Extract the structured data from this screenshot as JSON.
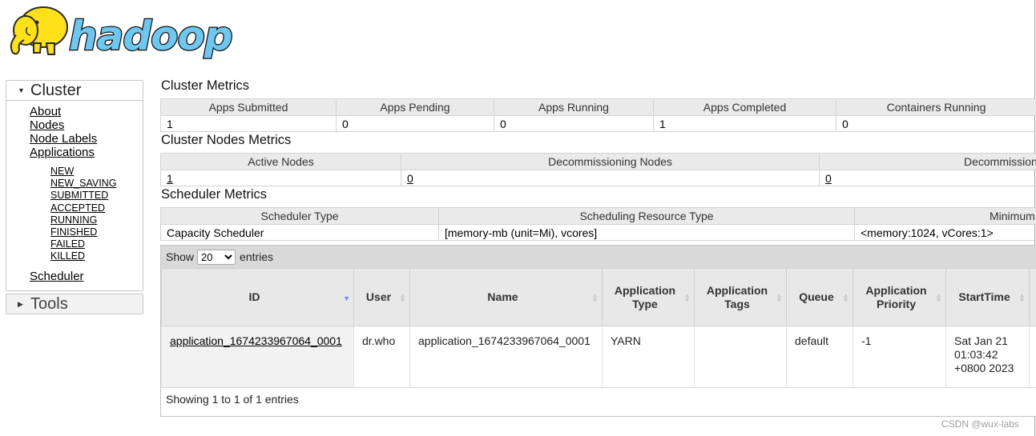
{
  "brand": {
    "logo_text": "hadoop"
  },
  "sidebar": {
    "cluster_header": "Cluster",
    "tools_header": "Tools",
    "links": [
      "About",
      "Nodes",
      "Node Labels",
      "Applications"
    ],
    "app_states": [
      "NEW",
      "NEW_SAVING",
      "SUBMITTED",
      "ACCEPTED",
      "RUNNING",
      "FINISHED",
      "FAILED",
      "KILLED"
    ],
    "scheduler": "Scheduler"
  },
  "cluster_metrics": {
    "title": "Cluster Metrics",
    "headers": [
      "Apps Submitted",
      "Apps Pending",
      "Apps Running",
      "Apps Completed",
      "Containers Running"
    ],
    "values": [
      "1",
      "0",
      "0",
      "1",
      "0"
    ]
  },
  "node_metrics": {
    "title": "Cluster Nodes Metrics",
    "headers": [
      "Active Nodes",
      "Decommissioning Nodes",
      "Decommission"
    ],
    "values": [
      "1",
      "0",
      "0"
    ]
  },
  "scheduler_metrics": {
    "title": "Scheduler Metrics",
    "headers": [
      "Scheduler Type",
      "Scheduling Resource Type",
      "Minimum"
    ],
    "values": [
      "Capacity Scheduler",
      "[memory-mb (unit=Mi), vcores]",
      "<memory:1024, vCores:1>"
    ]
  },
  "apps": {
    "show_label": "Show",
    "show_value": "20",
    "entries_label": "entries",
    "headers": [
      "ID",
      "User",
      "Name",
      "Application Type",
      "Application Tags",
      "Queue",
      "Application Priority",
      "StartTime"
    ],
    "rows": [
      {
        "id": "application_1674233967064_0001",
        "user": "dr.who",
        "name": "application_1674233967064_0001",
        "type": "YARN",
        "tags": "",
        "queue": "default",
        "priority": "-1",
        "start_time": "Sat Jan 21 01:03:42 +0800 2023"
      }
    ],
    "info": "Showing 1 to 1 of 1 entries"
  },
  "watermark": "CSDN @wux-labs",
  "colors": {
    "logo_yellow": "#ffe11a",
    "logo_blue": "#6fc7f0",
    "sort_active": "#7a86d6"
  }
}
